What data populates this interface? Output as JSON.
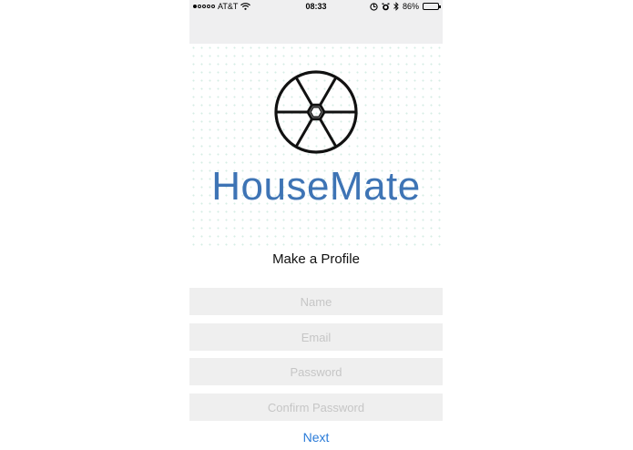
{
  "status_bar": {
    "carrier": "AT&T",
    "time": "08:33",
    "battery": "86%",
    "battery_level": 0.86,
    "signal_bars": 1,
    "icons": [
      "signal-dots-icon",
      "wifi-icon",
      "location-lock-icon",
      "alarm-icon",
      "bluetooth-icon",
      "battery-icon"
    ]
  },
  "branding": {
    "app_name": "HouseMate",
    "logo_icon": "hexagon-wheel-logo-icon",
    "brand_color": "#3e74b5"
  },
  "form": {
    "heading": "Make a Profile",
    "name_placeholder": "Name",
    "email_placeholder": "Email",
    "password_placeholder": "Password",
    "confirm_password_placeholder": "Confirm Password",
    "next_label": "Next",
    "link_color": "#2a7bd8"
  }
}
